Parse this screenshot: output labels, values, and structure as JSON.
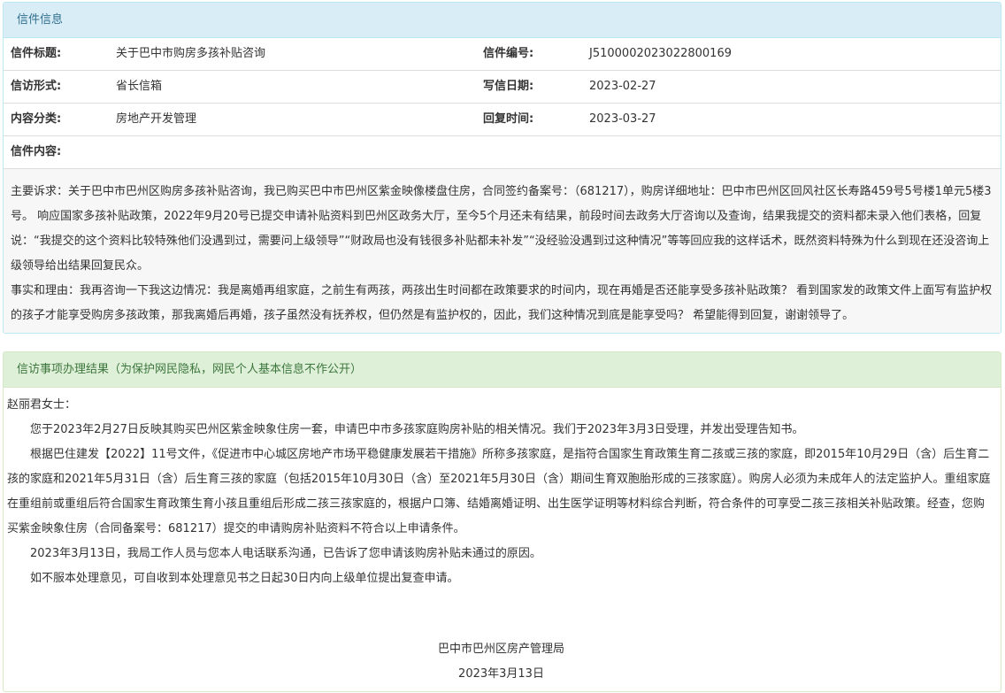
{
  "letter_info": {
    "heading": "信件信息",
    "rows": [
      {
        "label1": "信件标题:",
        "value1": "关于巴中市购房多孩补贴咨询",
        "label2": "信件编号:",
        "value2": "J5100002023022800169"
      },
      {
        "label1": "信访形式:",
        "value1": "省长信箱",
        "label2": "写信日期:",
        "value2": "2023-02-27"
      },
      {
        "label1": "内容分类:",
        "value1": "房地产开发管理",
        "label2": "回复时间:",
        "value2": "2023-03-27"
      }
    ],
    "content_label": "信件内容:",
    "content_paragraphs": [
      "主要诉求：关于巴中市巴州区购房多孩补贴咨询，我已购买巴中市巴州区紫金映像楼盘住房，合同签约备案号：（681217），购房详细地址：巴中市巴州区回风社区长寿路459号5号楼1单元5楼3号。 响应国家多孩补贴政策，2022年9月20号已提交申请补贴资料到巴州区政务大厅，至今5个月还未有结果，前段时间去政务大厅咨询以及查询，结果我提交的资料都未录入他们表格，回复说：“我提交的这个资料比较特殊他们没遇到过，需要问上级领导”“财政局也没有钱很多补贴都未补发”“没经验没遇到过这种情况”等等回应我的这样话术，既然资料特殊为什么到现在还没咨询上级领导给出结果回复民众。",
      "事实和理由：我再咨询一下我这边情况：我是离婚再组家庭，之前生有两孩，两孩出生时间都在政策要求的时间内，现在再婚是否还能享受多孩补贴政策？ 看到国家发的政策文件上面写有监护权的孩子才能享受购房多孩政策，那我离婚后再婚，孩子虽然没有抚养权，但仍然是有监护权的，因此，我们这种情况到底是能享受吗？ 希望能得到回复，谢谢领导了。"
    ]
  },
  "result": {
    "heading": "信访事项办理结果（为保护网民隐私，网民个人基本信息不作公开）",
    "salutation": "赵丽君女士：",
    "paragraphs": [
      "您于2023年2月27日反映其购买巴州区紫金映象住房一套，申请巴中市多孩家庭购房补贴的相关情况。我们于2023年3月3日受理，并发出受理告知书。",
      "根据巴住建发【2022】11号文件，《促进市中心城区房地产市场平稳健康发展若干措施》所称多孩家庭，是指符合国家生育政策生育二孩或三孩的家庭，即2015年10月29日（含）后生育二孩的家庭和2021年5月31日（含）后生育三孩的家庭（包括2015年10月30日（含）至2021年5月30日（含）期间生育双胞胎形成的三孩家庭）。购房人必须为未成年人的法定监护人。重组家庭在重组前或重组后符合国家生育政策生育小孩且重组后形成二孩三孩家庭的，根据户口簿、结婚离婚证明、出生医学证明等材料综合判断，符合条件的可享受二孩三孩相关补贴政策。经查，您购买紫金映象住房（合同备案号：681217）提交的申请购房补贴资料不符合以上申请条件。",
      "2023年3月13日，我局工作人员与您本人电话联系沟通，已告诉了您申请该购房补贴未通过的原因。",
      "如不服本处理意见，可自收到本处理意见书之日起30日内向上级单位提出复查申请。"
    ],
    "signature_org": "巴中市巴州区房产管理局",
    "signature_date": "2023年3月13日"
  }
}
